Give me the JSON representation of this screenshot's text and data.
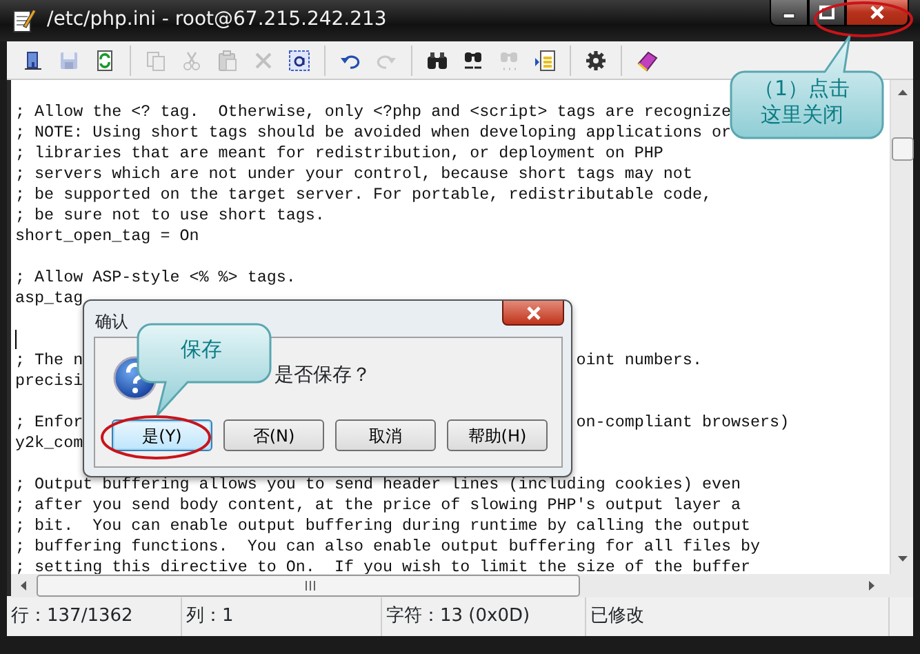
{
  "window": {
    "title": "/etc/php.ini - root@67.215.242.213"
  },
  "toolbar": [
    {
      "kind": "open",
      "disabled": false
    },
    {
      "kind": "save",
      "disabled": true
    },
    {
      "kind": "reload",
      "disabled": false
    },
    {
      "kind": "sep"
    },
    {
      "kind": "copy",
      "disabled": true
    },
    {
      "kind": "cut",
      "disabled": true
    },
    {
      "kind": "paste",
      "disabled": true
    },
    {
      "kind": "delete",
      "disabled": true
    },
    {
      "kind": "selectall",
      "disabled": false
    },
    {
      "kind": "sep"
    },
    {
      "kind": "undo",
      "disabled": false
    },
    {
      "kind": "redo",
      "disabled": true
    },
    {
      "kind": "sep"
    },
    {
      "kind": "find",
      "disabled": false
    },
    {
      "kind": "replace",
      "disabled": false
    },
    {
      "kind": "findnext",
      "disabled": true
    },
    {
      "kind": "gotoline",
      "disabled": false
    },
    {
      "kind": "sep"
    },
    {
      "kind": "settings",
      "disabled": false
    },
    {
      "kind": "sep"
    },
    {
      "kind": "help",
      "disabled": false
    }
  ],
  "editor": {
    "lines": [
      {
        "text": "; Allow the <? tag.  Otherwise, only <?php and <script> tags are recognize",
        "cursor": false
      },
      {
        "text": "; NOTE: Using short tags should be avoided when developing applications or",
        "cursor": false
      },
      {
        "text": "; libraries that are meant for redistribution, or deployment on PHP",
        "cursor": false
      },
      {
        "text": "; servers which are not under your control, because short tags may not",
        "cursor": false
      },
      {
        "text": "; be supported on the target server. For portable, redistributable code,",
        "cursor": false
      },
      {
        "text": "; be sure not to use short tags.",
        "cursor": false
      },
      {
        "text": "short_open_tag = On",
        "cursor": false
      },
      {
        "cursor": false
      },
      {
        "text": "; Allow ASP-style <% %> tags.",
        "cursor": false
      },
      {
        "text": "asp_tag",
        "cursor": false
      },
      {
        "cursor": false
      },
      {
        "cursor": true
      },
      {
        "text": "; The n",
        "text_right": "oint numbers.",
        "cursor": false
      },
      {
        "text": "precisi",
        "cursor": false
      },
      {
        "cursor": false
      },
      {
        "text": "; Enfor",
        "text_right": "on-compliant browsers)",
        "cursor": false
      },
      {
        "text": "y2k_com",
        "cursor": false
      },
      {
        "cursor": false
      },
      {
        "text": "; Output buffering allows you to send header lines (including cookies) even",
        "cursor": false
      },
      {
        "text": "; after you send body content, at the price of slowing PHP's output layer a",
        "cursor": false
      },
      {
        "text": "; bit.  You can enable output buffering during runtime by calling the output",
        "cursor": false
      },
      {
        "text": "; buffering functions.  You can also enable output buffering for all files by",
        "cursor": false
      },
      {
        "text": "; setting this directive to On.  If you wish to limit the size of the buffer",
        "cursor": false
      }
    ]
  },
  "dialog": {
    "title": "确认",
    "message": "是否保存？",
    "buttons": [
      {
        "label": "是(Y)",
        "selected": true
      },
      {
        "label": "否(N)",
        "selected": false
      },
      {
        "label": "取消",
        "selected": false
      },
      {
        "label": "帮助(H)",
        "selected": false
      }
    ]
  },
  "status_bar": [
    "行：137/1362",
    "列：1",
    "字符：13 (0x0D)",
    "已修改"
  ],
  "annotations": [
    {
      "kind": "close",
      "text": "（1）点击这里关闭"
    },
    {
      "kind": "save",
      "text": "保存"
    }
  ]
}
